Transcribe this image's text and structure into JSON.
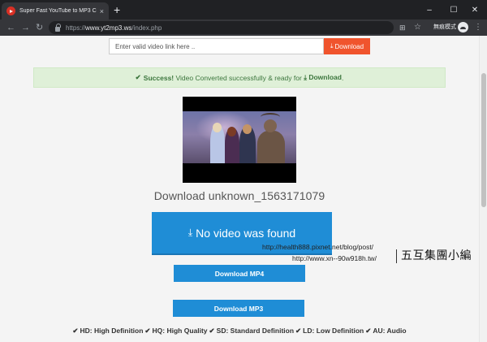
{
  "browser": {
    "tab_title": "Super Fast YouTube to MP3 Co",
    "tab_close": "×",
    "new_tab": "+",
    "url_prefix": "https://",
    "url_host": "www.yt2mp3.ws",
    "url_path": "/index.php",
    "profile_label": "無痕模式",
    "window_controls": {
      "minimize": "–",
      "maximize": "☐",
      "close": "✕"
    },
    "nav": {
      "back": "←",
      "forward": "→",
      "reload": "↻"
    },
    "toolbar_icons": {
      "translate": "⊞",
      "bookmark": "☆",
      "menu": "⋮"
    }
  },
  "search": {
    "placeholder": "Enter valid video link here ..",
    "button_label": "Download",
    "button_icon": "⤓"
  },
  "alert": {
    "check": "✔",
    "strong": "Success!",
    "text": "Video Converted successfully & ready for",
    "icon": "⤓",
    "link": "Download",
    "end": ".",
    "color": "#3c763d"
  },
  "video": {
    "title": "Download unknown_1563171079",
    "main_button_icon": "⤓",
    "main_button": "No video was found",
    "mp4_button": "Download MP4",
    "mp3_button": "Download MP3",
    "accent": "#1f8dd6"
  },
  "watermark": {
    "line1": "http://health888.pixnet.net/blog/post/",
    "line2": "http://www.xn--90w918h.tw/",
    "name": "五互集團小編"
  },
  "legend": {
    "check": "✔",
    "items": [
      "HD: High Definition",
      "HQ: High Quality",
      "SD: Standard Definition",
      "LD: Low Definition",
      "AU: Audio"
    ]
  }
}
